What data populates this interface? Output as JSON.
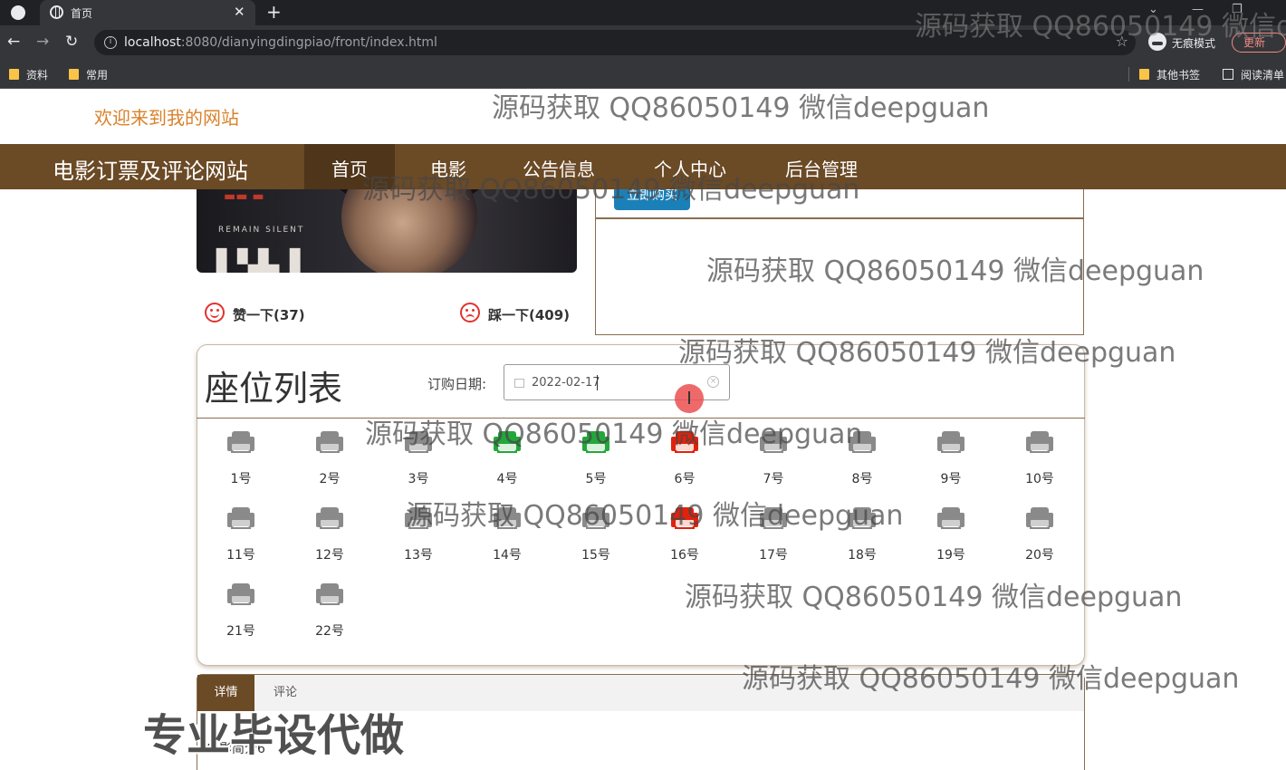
{
  "browser": {
    "tab_title": "首页",
    "url_host": "localhost",
    "url_rest": ":8080/dianyingdingpiao/front/index.html",
    "incognito_label": "无痕模式",
    "update_label": "更新",
    "bookmarks": [
      "资料",
      "常用"
    ],
    "other_bookmarks": "其他书签",
    "reading_list": "阅读清单"
  },
  "site": {
    "welcome": "欢迎来到我的网站",
    "brand": "电影订票及评论网站",
    "nav": [
      "首页",
      "电影",
      "公告信息",
      "个人中心",
      "后台管理"
    ]
  },
  "movie": {
    "like_label": "赞一下(37)",
    "dislike_label": "踩一下(409)",
    "buy_label": "立即购买",
    "poster_text": "REMAIN SILENT"
  },
  "seats": {
    "title": "座位列表",
    "date_label": "订购日期:",
    "date_value": "2022-02-17",
    "legend_colors": {
      "available": "#8a8a8a",
      "selected": "#23a73a",
      "sold": "#e0220c"
    },
    "items": [
      {
        "label": "1号",
        "status": "available"
      },
      {
        "label": "2号",
        "status": "available"
      },
      {
        "label": "3号",
        "status": "available"
      },
      {
        "label": "4号",
        "status": "selected"
      },
      {
        "label": "5号",
        "status": "selected"
      },
      {
        "label": "6号",
        "status": "sold"
      },
      {
        "label": "7号",
        "status": "available"
      },
      {
        "label": "8号",
        "status": "available"
      },
      {
        "label": "9号",
        "status": "available"
      },
      {
        "label": "10号",
        "status": "available"
      },
      {
        "label": "11号",
        "status": "available"
      },
      {
        "label": "12号",
        "status": "available"
      },
      {
        "label": "13号",
        "status": "available"
      },
      {
        "label": "14号",
        "status": "available"
      },
      {
        "label": "15号",
        "status": "available"
      },
      {
        "label": "16号",
        "status": "sold"
      },
      {
        "label": "17号",
        "status": "available"
      },
      {
        "label": "18号",
        "status": "available"
      },
      {
        "label": "19号",
        "status": "available"
      },
      {
        "label": "20号",
        "status": "available"
      },
      {
        "label": "21号",
        "status": "available"
      },
      {
        "label": "22号",
        "status": "available"
      }
    ]
  },
  "tabs": {
    "detail": "详情",
    "comment": "评论",
    "intro": "电影简介6"
  },
  "overlay": {
    "watermark": "源码获取 QQ86050149 微信deepguan",
    "watermark_top": "源码获取 QQ86050149 微信d",
    "promo": "专业毕设代做"
  }
}
